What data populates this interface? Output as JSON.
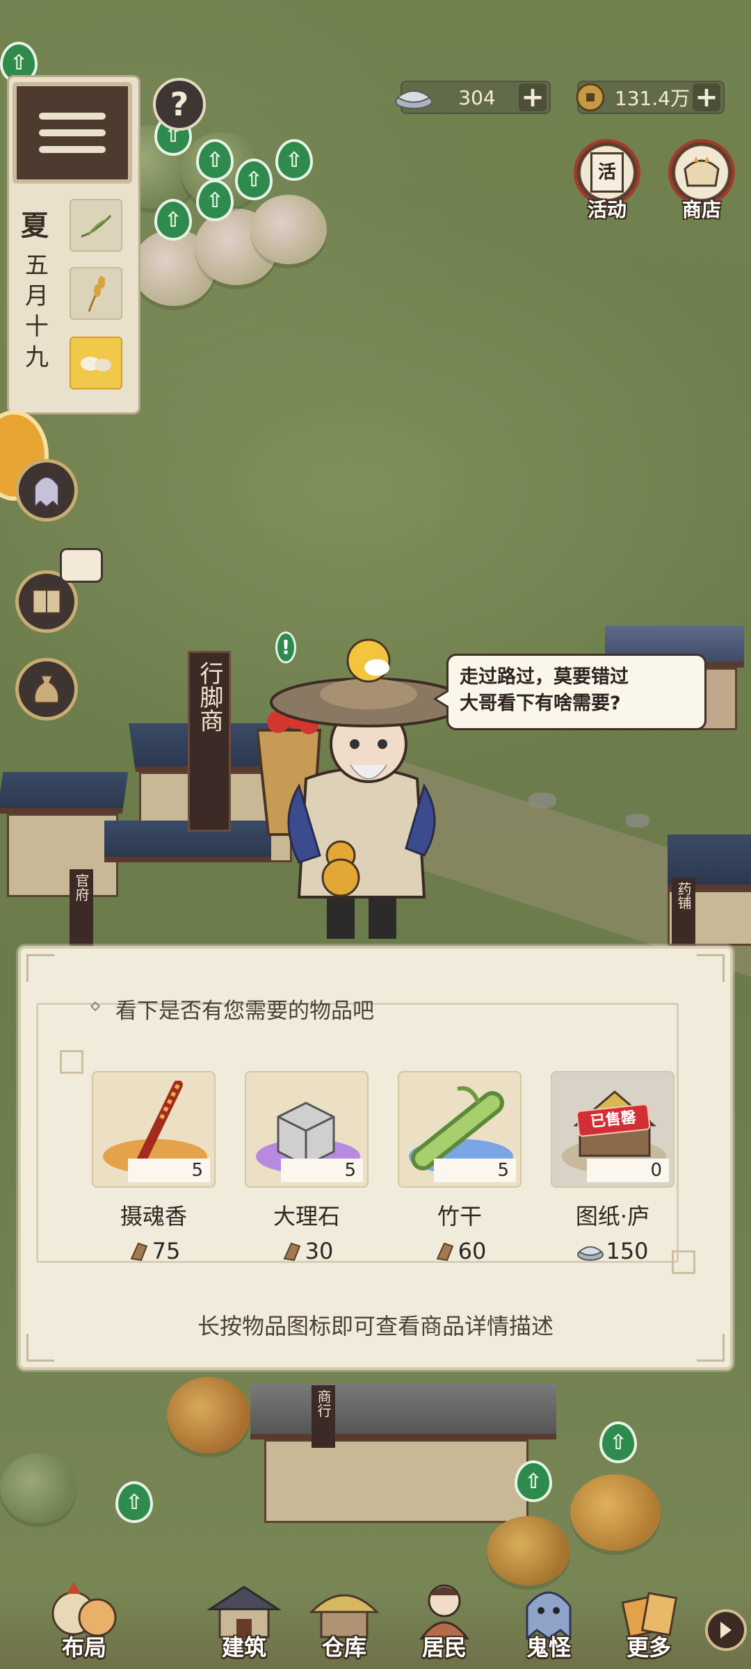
{
  "currency": {
    "silver_ingot": "304",
    "copper_coin": "131.4万"
  },
  "shortcuts": {
    "activity_label": "活动",
    "activity_glyph": "活",
    "shop_label": "商店"
  },
  "calendar": {
    "season": "夏",
    "date_chars": [
      "五",
      "月",
      "十",
      "九"
    ]
  },
  "help_symbol": "?",
  "npc": {
    "banner": "行脚商",
    "speech_line1": "走过路过，莫要错过",
    "speech_line2": "大哥看下有啥需要?"
  },
  "map_labels": {
    "guanfu": "官府",
    "yaopu": "药铺",
    "shanghang": "商行"
  },
  "shop": {
    "title": "看下是否有您需要的物品吧",
    "hint": "长按物品图标即可查看商品详情描述",
    "items": [
      {
        "name": "摄魂香",
        "qty": "5",
        "price": "75",
        "currency_icon": "copper-coin-icon",
        "disc_color": "#e4a24a"
      },
      {
        "name": "大理石",
        "qty": "5",
        "price": "30",
        "currency_icon": "copper-coin-icon",
        "disc_color": "#b88adf"
      },
      {
        "name": "竹干",
        "qty": "5",
        "price": "60",
        "currency_icon": "copper-coin-icon",
        "disc_color": "#7aa6e6"
      },
      {
        "name": "图纸·庐",
        "qty": "0",
        "price": "150",
        "currency_icon": "silver-ingot-icon",
        "disc_color": "#d8c9a8",
        "sold_label": "已售罄"
      }
    ]
  },
  "bottom_nav": [
    {
      "label": "布局",
      "icon": "layout-icon"
    },
    {
      "label": "建筑",
      "icon": "building-icon"
    },
    {
      "label": "仓库",
      "icon": "warehouse-icon"
    },
    {
      "label": "居民",
      "icon": "residents-icon"
    },
    {
      "label": "鬼怪",
      "icon": "ghost-icon"
    },
    {
      "label": "更多",
      "icon": "more-icon"
    }
  ],
  "colors": {
    "grass": "#71824f",
    "panel": "#f1ebdb",
    "upgrade_badge": "#2f8a4d",
    "sold_red": "#d12f35"
  }
}
